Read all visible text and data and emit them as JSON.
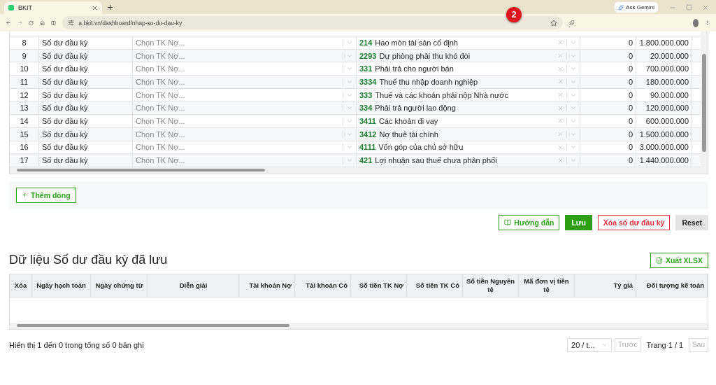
{
  "browser": {
    "tab_title": "BKIT",
    "url": "a.bkit.vn/dashboard/nhap-so-du-dau-ky",
    "gemini": "Ask Gemini",
    "badge": "2"
  },
  "entry_table": {
    "rows": [
      {
        "index": "8",
        "type": "Số dư đầu kỳ",
        "debit_placeholder": "Chọn TK Nợ...",
        "credit_code": "214",
        "credit_name": "Hao mòn tài sản cố định",
        "debit_amount": "0",
        "credit_amount": "1.800.000.000"
      },
      {
        "index": "9",
        "type": "Số dư đầu kỳ",
        "debit_placeholder": "Chọn TK Nợ...",
        "credit_code": "2293",
        "credit_name": "Dự phòng phải thu khó đòi",
        "debit_amount": "0",
        "credit_amount": "20.000.000"
      },
      {
        "index": "10",
        "type": "Số dư đầu kỳ",
        "debit_placeholder": "Chọn TK Nợ...",
        "credit_code": "331",
        "credit_name": "Phải trả cho người bán",
        "debit_amount": "0",
        "credit_amount": "700.000.000"
      },
      {
        "index": "11",
        "type": "Số dư đầu kỳ",
        "debit_placeholder": "Chọn TK Nợ...",
        "credit_code": "3334",
        "credit_name": "Thuế thu nhập doanh nghiệp",
        "debit_amount": "0",
        "credit_amount": "180.000.000"
      },
      {
        "index": "12",
        "type": "Số dư đầu kỳ",
        "debit_placeholder": "Chọn TK Nợ...",
        "credit_code": "333",
        "credit_name": "Thuế và các khoản phải nộp Nhà nước",
        "debit_amount": "0",
        "credit_amount": "90.000.000"
      },
      {
        "index": "13",
        "type": "Số dư đầu kỳ",
        "debit_placeholder": "Chọn TK Nợ...",
        "credit_code": "334",
        "credit_name": "Phải trả người lao động",
        "debit_amount": "0",
        "credit_amount": "120.000.000"
      },
      {
        "index": "14",
        "type": "Số dư đầu kỳ",
        "debit_placeholder": "Chọn TK Nợ...",
        "credit_code": "3411",
        "credit_name": "Các khoản đi vay",
        "debit_amount": "0",
        "credit_amount": "600.000.000"
      },
      {
        "index": "15",
        "type": "Số dư đầu kỳ",
        "debit_placeholder": "Chọn TK Nợ...",
        "credit_code": "3412",
        "credit_name": "Nợ thuê tài chính",
        "debit_amount": "0",
        "credit_amount": "1.500.000.000"
      },
      {
        "index": "16",
        "type": "Số dư đầu kỳ",
        "debit_placeholder": "Chọn TK Nợ...",
        "credit_code": "4111",
        "credit_name": "Vốn góp của chủ sở hữu",
        "debit_amount": "0",
        "credit_amount": "3.000.000.000"
      },
      {
        "index": "17",
        "type": "Số dư đầu kỳ",
        "debit_placeholder": "Chọn TK Nợ...",
        "credit_code": "421",
        "credit_name": "Lợi nhuận sau thuế chưa phân phối",
        "debit_amount": "0",
        "credit_amount": "1.440.000.000"
      }
    ],
    "add_row": "Thêm dòng"
  },
  "actions": {
    "guide": "Hướng dẫn",
    "save": "Lưu",
    "delete": "Xóa số dư đầu kỳ",
    "reset": "Reset"
  },
  "saved": {
    "title": "Dữ liệu Số dư đầu kỳ đã lưu",
    "export": "Xuất XLSX",
    "columns": [
      "Xóa",
      "Ngày hạch toán",
      "Ngày chứng từ",
      "Diễn giải",
      "Tài khoản Nợ",
      "Tài khoản Có",
      "Số tiền TK Nợ",
      "Số tiền TK Có",
      "Số tiền Nguyên tệ",
      "Mã đơn vị tiền tệ",
      "Tỷ giá",
      "Đối tượng kế toán"
    ]
  },
  "footer": {
    "summary": "Hiển thị 1 đến 0 trong tổng số 0 bản ghi",
    "page_size": "20 / t...",
    "prev": "Trước",
    "page": "Trang 1 / 1",
    "next": "Sau"
  }
}
